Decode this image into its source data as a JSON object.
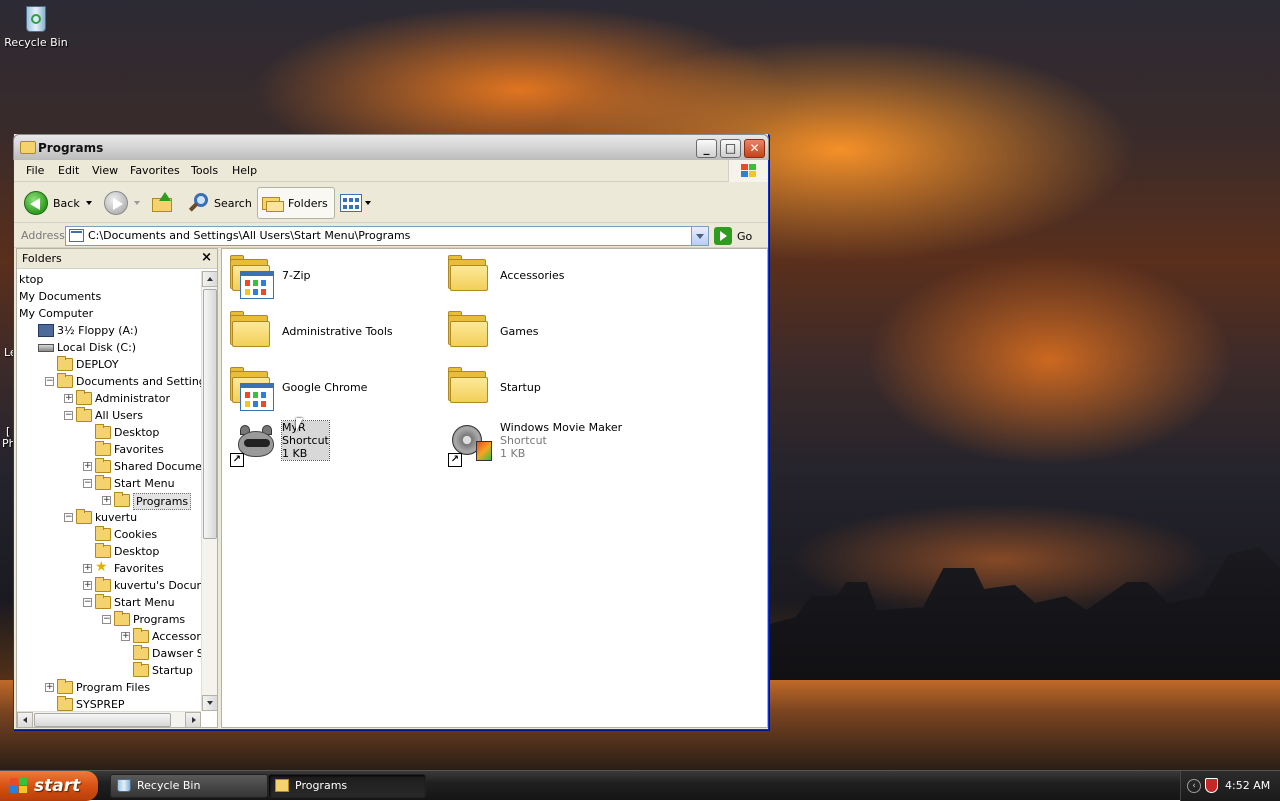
{
  "desktop": {
    "icons": [
      {
        "label": "Recycle Bin",
        "icon": "recycle-bin-icon"
      }
    ],
    "edge_fragments": [
      "Le",
      "[",
      "Ph"
    ]
  },
  "window": {
    "title": "Programs",
    "controls": {
      "minimize": "_",
      "maximize": "□",
      "close": "✕"
    },
    "menu": [
      "File",
      "Edit",
      "View",
      "Favorites",
      "Tools",
      "Help"
    ],
    "toolbar": {
      "back_label": "Back",
      "search_label": "Search",
      "folders_label": "Folders"
    },
    "address": {
      "label": "Address",
      "value": "C:\\Documents and Settings\\All Users\\Start Menu\\Programs",
      "go_label": "Go"
    },
    "folders_pane": {
      "title": "Folders",
      "close": "×",
      "tree": [
        {
          "label": "ktop",
          "indent": 0,
          "icon": "none",
          "expander": ""
        },
        {
          "label": "My Documents",
          "indent": 0,
          "icon": "none",
          "expander": ""
        },
        {
          "label": "My Computer",
          "indent": 0,
          "icon": "none",
          "expander": ""
        },
        {
          "label": "3½ Floppy (A:)",
          "indent": 1,
          "icon": "floppy",
          "expander": ""
        },
        {
          "label": "Local Disk (C:)",
          "indent": 1,
          "icon": "disk",
          "expander": ""
        },
        {
          "label": "DEPLOY",
          "indent": 2,
          "icon": "folder",
          "expander": ""
        },
        {
          "label": "Documents and Settings",
          "indent": 2,
          "icon": "folder",
          "expander": "-"
        },
        {
          "label": "Administrator",
          "indent": 3,
          "icon": "folder",
          "expander": "+"
        },
        {
          "label": "All Users",
          "indent": 3,
          "icon": "folder",
          "expander": "-"
        },
        {
          "label": "Desktop",
          "indent": 4,
          "icon": "folder",
          "expander": ""
        },
        {
          "label": "Favorites",
          "indent": 4,
          "icon": "folder",
          "expander": ""
        },
        {
          "label": "Shared Documents",
          "indent": 4,
          "icon": "folder",
          "expander": "+"
        },
        {
          "label": "Start Menu",
          "indent": 4,
          "icon": "folder",
          "expander": "-"
        },
        {
          "label": "Programs",
          "indent": 5,
          "icon": "folder",
          "expander": "+",
          "selected": true
        },
        {
          "label": "kuvertu",
          "indent": 3,
          "icon": "folder",
          "expander": "-"
        },
        {
          "label": "Cookies",
          "indent": 4,
          "icon": "folder",
          "expander": ""
        },
        {
          "label": "Desktop",
          "indent": 4,
          "icon": "folder",
          "expander": ""
        },
        {
          "label": "Favorites",
          "indent": 4,
          "icon": "star",
          "expander": "+"
        },
        {
          "label": "kuvertu's Documents",
          "indent": 4,
          "icon": "folder",
          "expander": "+"
        },
        {
          "label": "Start Menu",
          "indent": 4,
          "icon": "folder",
          "expander": "-"
        },
        {
          "label": "Programs",
          "indent": 5,
          "icon": "folder",
          "expander": "-"
        },
        {
          "label": "Accessories",
          "indent": 6,
          "icon": "folder",
          "expander": "+"
        },
        {
          "label": "Dawser Solutio",
          "indent": 6,
          "icon": "folder",
          "expander": ""
        },
        {
          "label": "Startup",
          "indent": 6,
          "icon": "folder",
          "expander": ""
        },
        {
          "label": "Program Files",
          "indent": 2,
          "icon": "folder",
          "expander": "+"
        },
        {
          "label": "SYSPREP",
          "indent": 2,
          "icon": "folder",
          "expander": ""
        }
      ]
    },
    "files": [
      {
        "name": "7-Zip",
        "type": "program-folder"
      },
      {
        "name": "Accessories",
        "type": "folder"
      },
      {
        "name": "Administrative Tools",
        "type": "folder"
      },
      {
        "name": "Games",
        "type": "folder"
      },
      {
        "name": "Google Chrome",
        "type": "program-folder"
      },
      {
        "name": "Startup",
        "type": "folder"
      },
      {
        "name": "MyR",
        "sub1": "Shortcut",
        "sub2": "1 KB",
        "type": "shortcut-raccoon",
        "selected": true
      },
      {
        "name": "Windows Movie Maker",
        "sub1": "Shortcut",
        "sub2": "1 KB",
        "type": "shortcut-moviemaker"
      }
    ]
  },
  "taskbar": {
    "start_label": "start",
    "tasks": [
      {
        "label": "Recycle Bin",
        "icon": "recycle-bin-icon",
        "active": false
      },
      {
        "label": "Programs",
        "icon": "folder-icon",
        "active": true
      }
    ],
    "clock": "4:52 AM",
    "tray_chevron": "‹"
  },
  "colors": {
    "title_active": "#d4d4d4",
    "start_orange": "#d65113",
    "folder_yellow": "#f4d36e",
    "selection_gray": "#d8d8d8"
  }
}
